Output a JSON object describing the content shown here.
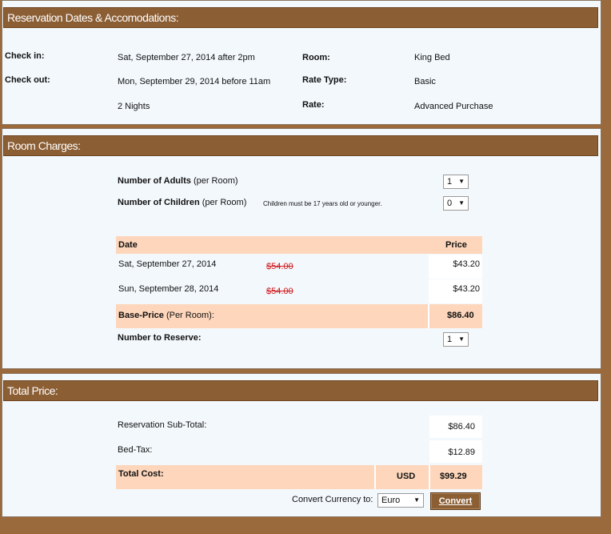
{
  "reservation": {
    "header": "Reservation Dates & Accomodations:",
    "checkin_label": "Check in:",
    "checkin_value": "Sat, September 27, 2014 after 2pm",
    "checkout_label": "Check out:",
    "checkout_value": "Mon, September 29, 2014 before 11am",
    "nights": "2 Nights",
    "room_label": "Room:",
    "room_value": "King Bed",
    "ratetype_label": "Rate Type:",
    "ratetype_value": "Basic",
    "rate_label": "Rate:",
    "rate_value": "Advanced Purchase"
  },
  "room_charges": {
    "header": "Room Charges:",
    "adults_label": "Number of Adults",
    "adults_suffix": "(per Room)",
    "adults_value": "1",
    "children_label": "Number of Children",
    "children_suffix": "(per Room)",
    "children_note": "Children must be 17 years old or younger.",
    "children_value": "0",
    "col_date": "Date",
    "col_price": "Price",
    "rows": [
      {
        "date": "Sat, September 27, 2014",
        "old_price": "$54.00",
        "price": "$43.20"
      },
      {
        "date": "Sun, September 28, 2014",
        "old_price": "$54.00",
        "price": "$43.20"
      }
    ],
    "base_label": "Base-Price",
    "base_suffix": "(Per Room):",
    "base_value": "$86.40",
    "reserve_label": "Number to Reserve:",
    "reserve_value": "1"
  },
  "total": {
    "header": "Total Price:",
    "subtotal_label": "Reservation Sub-Total:",
    "subtotal_value": "$86.40",
    "tax_label": "Bed-Tax:",
    "tax_value": "$12.89",
    "total_label": "Total Cost:",
    "currency": "USD",
    "total_value": "$99.29",
    "convert_label": "Convert Currency to:",
    "convert_value": "Euro",
    "convert_button": "Convert"
  },
  "icons": {
    "dropdown": "caret-down-icon"
  },
  "colors": {
    "header_bg": "#8b5e34",
    "peach": "#fdd6bb",
    "strike": "#d0191c",
    "page_bg": "#9a6a3c"
  }
}
